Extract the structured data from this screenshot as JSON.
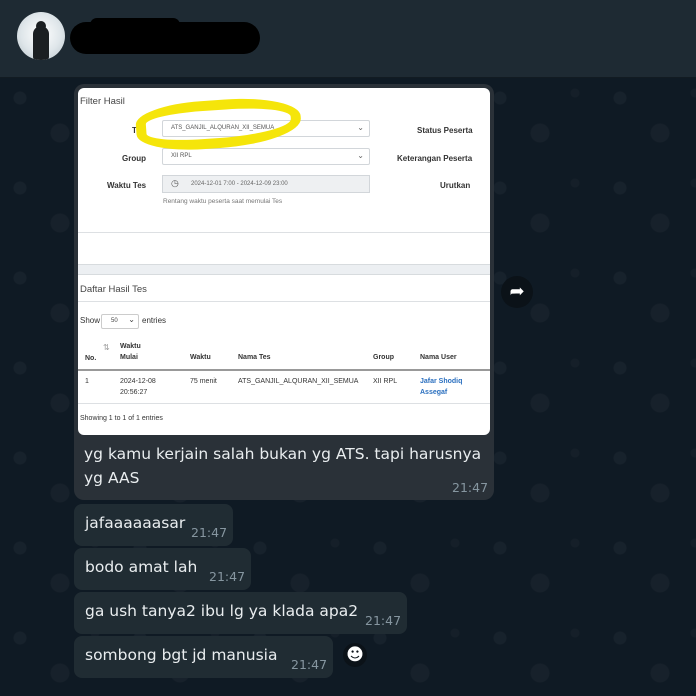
{
  "header": {
    "contact_name": ""
  },
  "screenshot": {
    "filter_title": "Filter Hasil",
    "fields": {
      "tes_label": "Tes",
      "tes_value": "ATS_GANJIL_ALQURAN_XII_SEMUA",
      "group_label": "Group",
      "group_value": "XII RPL",
      "waktu_label": "Waktu Tes",
      "waktu_value": "2024-12-01 7:00 - 2024-12-09 23:00",
      "waktu_hint": "Rentang waktu peserta saat memulai Tes",
      "status_peserta": "Status Peserta",
      "keterangan_peserta": "Keterangan Peserta",
      "urutkan": "Urutkan"
    },
    "daftar_title": "Daftar Hasil Tes",
    "show_label": "Show",
    "show_value": "50",
    "entries_label": "entries",
    "columns": {
      "no": "No.",
      "waktu_mulai_1": "Waktu",
      "waktu_mulai_2": "Mulai",
      "waktu": "Waktu",
      "nama_tes": "Nama Tes",
      "group": "Group",
      "nama_user": "Nama User"
    },
    "row": {
      "no": "1",
      "waktu_mulai_1": "2024-12-08",
      "waktu_mulai_2": "20:56:27",
      "waktu": "75 menit",
      "nama_tes": "ATS_GANJIL_ALQURAN_XII_SEMUA",
      "group": "XII RPL",
      "nama_user_1": "Jafar Shodiq",
      "nama_user_2": "Assegaf"
    },
    "footer": "Showing 1 to 1 of 1 entries"
  },
  "caption": {
    "line1": "yg kamu kerjain salah bukan yg ATS. tapi harusnya",
    "line2": "yg AAS",
    "time": "21:47"
  },
  "messages": [
    {
      "text": "jafaaaaaasar",
      "time": "21:47"
    },
    {
      "text": "bodo amat lah",
      "time": "21:47"
    },
    {
      "text": "ga ush tanya2 ibu lg ya klada apa2",
      "time": "21:47"
    },
    {
      "text": "sombong bgt jd manusia",
      "time": "21:47"
    }
  ],
  "icons": {
    "forward": "forward-icon",
    "emoji": "smiley-icon"
  }
}
